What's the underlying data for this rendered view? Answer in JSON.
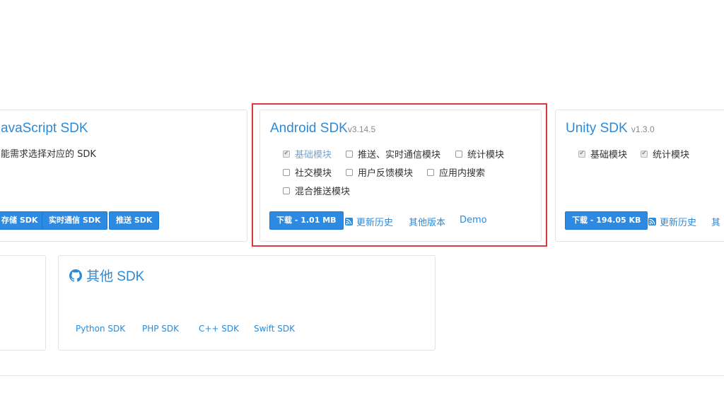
{
  "js_card": {
    "title": "avaScript SDK",
    "description": "能需求选择对应的 SDK",
    "buttons": [
      "存储 SDK",
      "实时通信 SDK",
      "推送 SDK"
    ]
  },
  "android_card": {
    "title": "Android SDK",
    "version": "v3.14.5",
    "modules": [
      {
        "label": "基础模块",
        "checked": true,
        "disabled": true
      },
      {
        "label": "推送、实时通信模块",
        "checked": false
      },
      {
        "label": "统计模块",
        "checked": false
      },
      {
        "label": "社交模块",
        "checked": false
      },
      {
        "label": "用户反馈模块",
        "checked": false
      },
      {
        "label": "应用内搜索",
        "checked": false
      },
      {
        "label": "混合推送模块",
        "checked": false
      }
    ],
    "download_label": "下载 - 1.01 MB",
    "history_label": "更新历史",
    "other_versions_label": "其他版本",
    "demo_label": "Demo"
  },
  "unity_card": {
    "title": "Unity SDK",
    "version": "v1.3.0",
    "modules": [
      {
        "label": "基础模块",
        "checked": true
      },
      {
        "label": "统计模块",
        "checked": true
      }
    ],
    "download_label": "下载 - 194.05 KB",
    "history_label": "更新历史",
    "other_label": "其"
  },
  "other_card": {
    "title": "其他 SDK",
    "links": [
      "Python SDK",
      "PHP SDK",
      "C++ SDK",
      "Swift SDK"
    ]
  },
  "colors": {
    "accent": "#2c8ad6",
    "button": "#2d8ae2",
    "highlight": "#e0373b"
  }
}
